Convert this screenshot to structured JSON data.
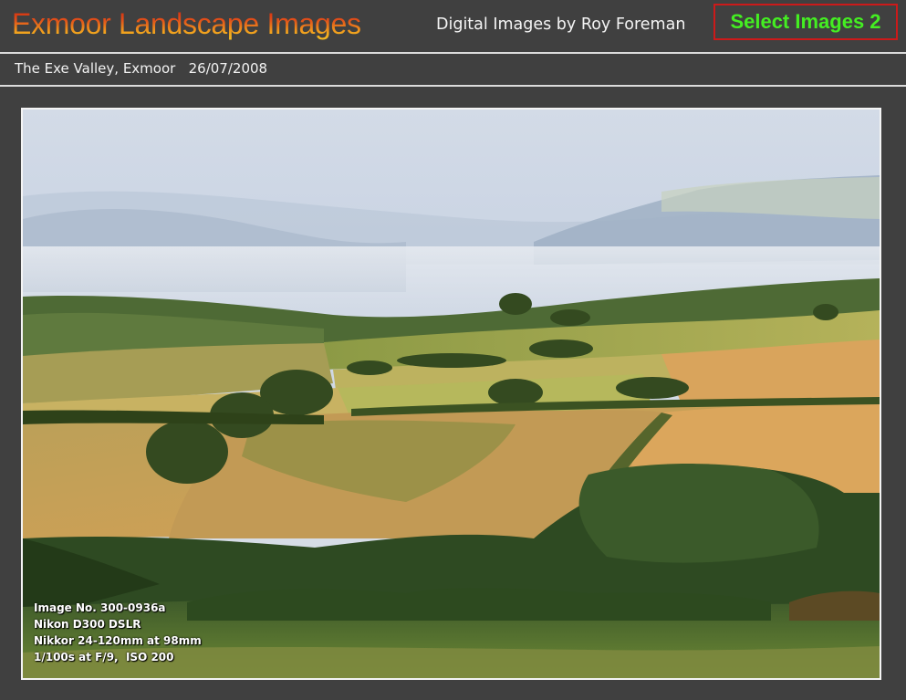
{
  "header": {
    "site_title": "Exmoor Landscape Images",
    "byline": "Digital Images by Roy Foreman",
    "select_button_label": "Select Images 2"
  },
  "caption": {
    "location": "The Exe Valley, Exmoor",
    "date": "26/07/2008"
  },
  "photo": {
    "description_alt": "The Exe Valley, Exmoor",
    "exif": [
      "Image No. 300-0936a",
      "Nikon D300 DSLR",
      "Nikkor 24-120mm at 98mm",
      "1/100s at F/9,  ISO 200"
    ]
  },
  "colors": {
    "background": "#404040",
    "select_border": "#cc1a1a",
    "select_text": "#44ee22"
  }
}
